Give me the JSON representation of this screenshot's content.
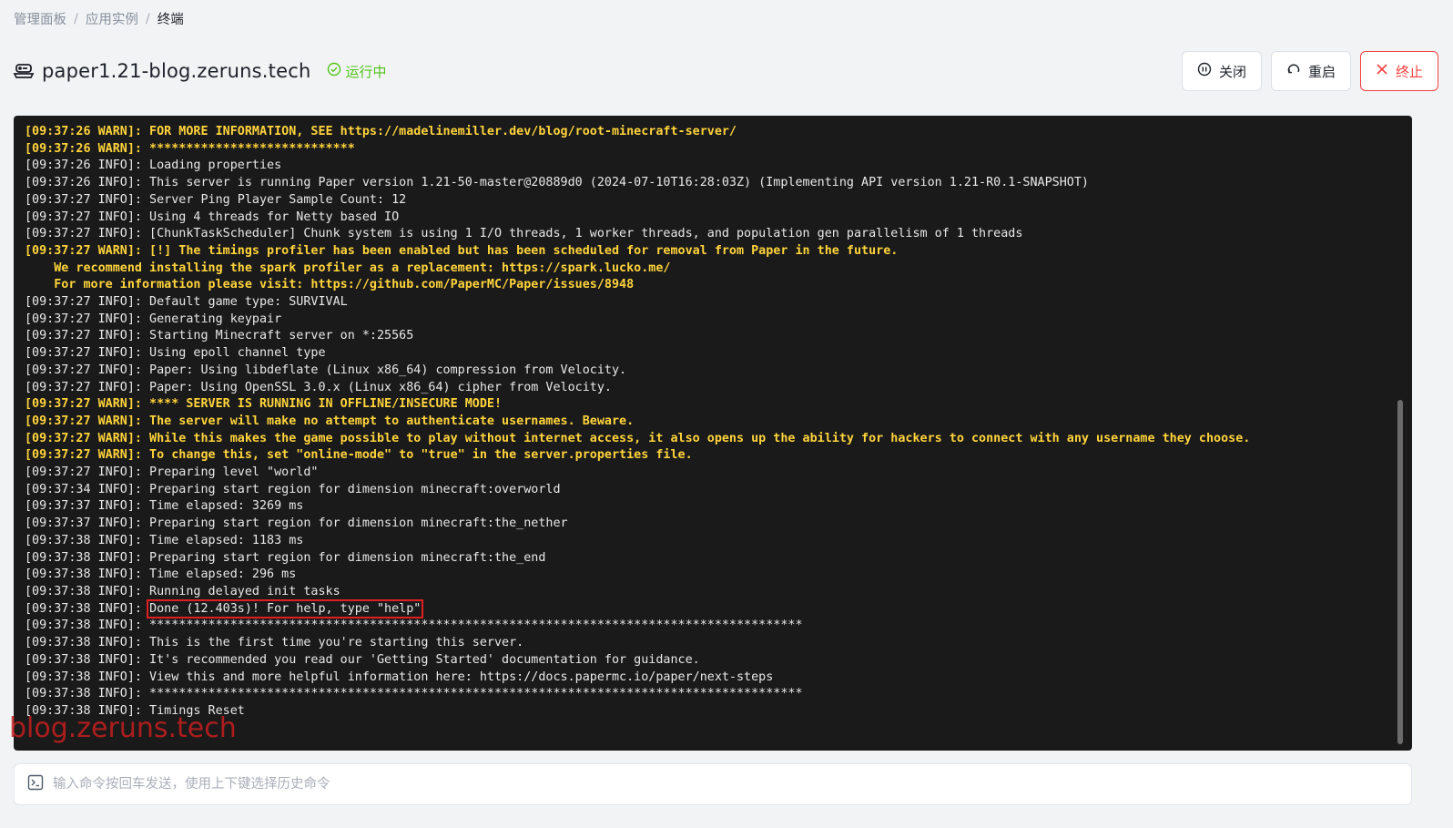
{
  "breadcrumb": [
    "管理面板",
    "应用实例",
    "终端"
  ],
  "breadcrumb_sep": "/",
  "header": {
    "title": "paper1.21-blog.zeruns.tech",
    "status": "运行中",
    "buttons": {
      "close": "关闭",
      "restart": "重启",
      "terminate": "终止"
    }
  },
  "colors": {
    "accent": "#52c41a",
    "danger": "#f53f3f",
    "warn_text": "#ffd43b",
    "highlight_box": "#e02020"
  },
  "terminal": {
    "lines": [
      {
        "text": "[09:37:26 WARN]: FOR MORE INFORMATION, SEE https://madelinemiller.dev/blog/root-minecraft-server/",
        "level": "warn"
      },
      {
        "text": "[09:37:26 WARN]: ****************************",
        "level": "warn"
      },
      {
        "text": "[09:37:26 INFO]: Loading properties",
        "level": "info"
      },
      {
        "text": "[09:37:26 INFO]: This server is running Paper version 1.21-50-master@20889d0 (2024-07-10T16:28:03Z) (Implementing API version 1.21-R0.1-SNAPSHOT)",
        "level": "info"
      },
      {
        "text": "[09:37:27 INFO]: Server Ping Player Sample Count: 12",
        "level": "info"
      },
      {
        "text": "[09:37:27 INFO]: Using 4 threads for Netty based IO",
        "level": "info"
      },
      {
        "text": "[09:37:27 INFO]: [ChunkTaskScheduler] Chunk system is using 1 I/O threads, 1 worker threads, and population gen parallelism of 1 threads",
        "level": "info"
      },
      {
        "text": "[09:37:27 WARN]: [!] The timings profiler has been enabled but has been scheduled for removal from Paper in the future.",
        "level": "warn"
      },
      {
        "text": "    We recommend installing the spark profiler as a replacement: https://spark.lucko.me/",
        "level": "warn"
      },
      {
        "text": "    For more information please visit: https://github.com/PaperMC/Paper/issues/8948",
        "level": "warn"
      },
      {
        "text": "[09:37:27 INFO]: Default game type: SURVIVAL",
        "level": "info"
      },
      {
        "text": "[09:37:27 INFO]: Generating keypair",
        "level": "info"
      },
      {
        "text": "[09:37:27 INFO]: Starting Minecraft server on *:25565",
        "level": "info"
      },
      {
        "text": "[09:37:27 INFO]: Using epoll channel type",
        "level": "info"
      },
      {
        "text": "[09:37:27 INFO]: Paper: Using libdeflate (Linux x86_64) compression from Velocity.",
        "level": "info"
      },
      {
        "text": "[09:37:27 INFO]: Paper: Using OpenSSL 3.0.x (Linux x86_64) cipher from Velocity.",
        "level": "info"
      },
      {
        "text": "[09:37:27 WARN]: **** SERVER IS RUNNING IN OFFLINE/INSECURE MODE!",
        "level": "warn"
      },
      {
        "text": "[09:37:27 WARN]: The server will make no attempt to authenticate usernames. Beware.",
        "level": "warn"
      },
      {
        "text": "[09:37:27 WARN]: While this makes the game possible to play without internet access, it also opens up the ability for hackers to connect with any username they choose.",
        "level": "warn"
      },
      {
        "text": "[09:37:27 WARN]: To change this, set \"online-mode\" to \"true\" in the server.properties file.",
        "level": "warn"
      },
      {
        "text": "[09:37:27 INFO]: Preparing level \"world\"",
        "level": "info"
      },
      {
        "text": "[09:37:34 INFO]: Preparing start region for dimension minecraft:overworld",
        "level": "info"
      },
      {
        "text": "[09:37:37 INFO]: Time elapsed: 3269 ms",
        "level": "info"
      },
      {
        "text": "[09:37:37 INFO]: Preparing start region for dimension minecraft:the_nether",
        "level": "info"
      },
      {
        "text": "[09:37:38 INFO]: Time elapsed: 1183 ms",
        "level": "info"
      },
      {
        "text": "[09:37:38 INFO]: Preparing start region for dimension minecraft:the_end",
        "level": "info"
      },
      {
        "text": "[09:37:38 INFO]: Time elapsed: 296 ms",
        "level": "info"
      },
      {
        "text": "[09:37:38 INFO]: Running delayed init tasks",
        "level": "info"
      },
      {
        "text": "[09:37:38 INFO]: ",
        "level": "info",
        "highlight": "Done (12.403s)! For help, type \"help\""
      },
      {
        "text": "[09:37:38 INFO]: *****************************************************************************************",
        "level": "info"
      },
      {
        "text": "[09:37:38 INFO]: This is the first time you're starting this server.",
        "level": "info"
      },
      {
        "text": "[09:37:38 INFO]: It's recommended you read our 'Getting Started' documentation for guidance.",
        "level": "info"
      },
      {
        "text": "[09:37:38 INFO]: View this and more helpful information here: https://docs.papermc.io/paper/next-steps",
        "level": "info"
      },
      {
        "text": "[09:37:38 INFO]: *****************************************************************************************",
        "level": "info"
      },
      {
        "text": "[09:37:38 INFO]: Timings Reset",
        "level": "info"
      }
    ]
  },
  "watermark": "blog.zeruns.tech",
  "command_input": {
    "placeholder": "输入命令按回车发送，使用上下键选择历史命令",
    "value": ""
  },
  "icons": {
    "title": "server-icon",
    "status": "check-circle-icon",
    "close": "pause-circle-icon",
    "restart": "restart-icon",
    "terminate": "close-x-icon",
    "prompt": "terminal-prompt-icon"
  }
}
